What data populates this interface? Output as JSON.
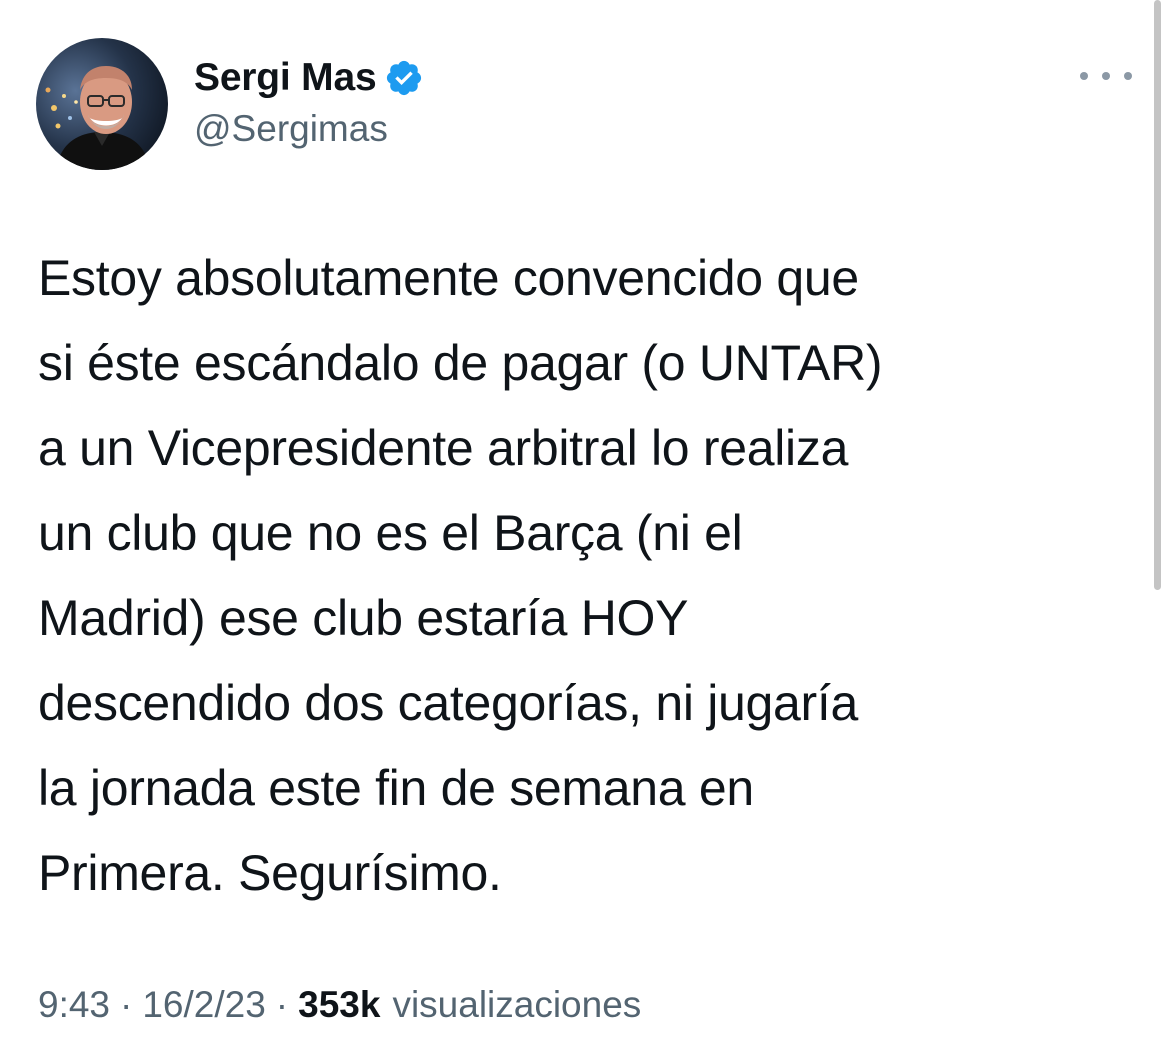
{
  "author": {
    "display_name": "Sergi Mas",
    "handle": "@Sergimas",
    "avatar_icon": "profile-photo",
    "verified_icon": "verified-badge-icon",
    "verified_color": "#1d9bf0"
  },
  "more_icon": "more-options-icon",
  "tweet": {
    "text": "Estoy absolutamente convencido que\nsi éste escándalo de pagar (o UNTAR)\na un Vicepresidente arbitral lo realiza\nun club que no es el Barça (ni el\nMadrid) ese club estaría HOY\ndescendido dos categorías, ni jugaría\nla jornada este fin de semana en\nPrimera. Segurísimo."
  },
  "meta": {
    "time": "9:43",
    "separator": "·",
    "date": "16/2/23",
    "views_count": "353k",
    "views_label": "visualizaciones"
  }
}
